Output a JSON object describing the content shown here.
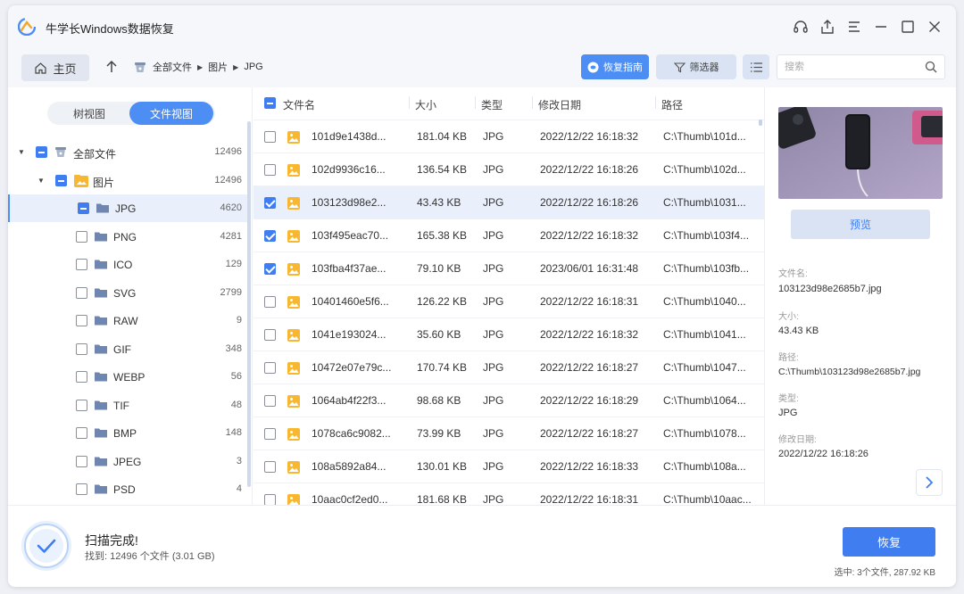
{
  "app": {
    "title": "牛学长Windows数据恢复"
  },
  "toolbar": {
    "home_label": "主页",
    "breadcrumb": [
      "全部文件",
      "图片",
      "JPG"
    ],
    "guide_label": "恢复指南",
    "filter_label": "筛选器",
    "search_placeholder": "搜索"
  },
  "sidebar": {
    "tab_tree": "树视图",
    "tab_file": "文件视图",
    "items": [
      {
        "label": "全部文件",
        "count": "12496",
        "level": 0,
        "check": "partial",
        "icon": "drive-icon"
      },
      {
        "label": "图片",
        "count": "12496",
        "level": 1,
        "check": "partial",
        "icon": "image-folder-icon"
      },
      {
        "label": "JPG",
        "count": "4620",
        "level": 2,
        "check": "partial",
        "icon": "folder-icon",
        "selected": true
      },
      {
        "label": "PNG",
        "count": "4281",
        "level": 2,
        "check": "empty",
        "icon": "folder-icon"
      },
      {
        "label": "ICO",
        "count": "129",
        "level": 2,
        "check": "empty",
        "icon": "folder-icon"
      },
      {
        "label": "SVG",
        "count": "2799",
        "level": 2,
        "check": "empty",
        "icon": "folder-icon"
      },
      {
        "label": "RAW",
        "count": "9",
        "level": 2,
        "check": "empty",
        "icon": "folder-icon"
      },
      {
        "label": "GIF",
        "count": "348",
        "level": 2,
        "check": "empty",
        "icon": "folder-icon"
      },
      {
        "label": "WEBP",
        "count": "56",
        "level": 2,
        "check": "empty",
        "icon": "folder-icon"
      },
      {
        "label": "TIF",
        "count": "48",
        "level": 2,
        "check": "empty",
        "icon": "folder-icon"
      },
      {
        "label": "BMP",
        "count": "148",
        "level": 2,
        "check": "empty",
        "icon": "folder-icon"
      },
      {
        "label": "JPEG",
        "count": "3",
        "level": 2,
        "check": "empty",
        "icon": "folder-icon"
      },
      {
        "label": "PSD",
        "count": "4",
        "level": 2,
        "check": "empty",
        "icon": "folder-icon"
      }
    ]
  },
  "table": {
    "headers": {
      "name": "文件名",
      "size": "大小",
      "type": "类型",
      "date": "修改日期",
      "path": "路径"
    },
    "rows": [
      {
        "name": "101d9e1438d...",
        "size": "181.04 KB",
        "type": "JPG",
        "date": "2022/12/22 16:18:32",
        "path": "C:\\Thumb\\101d...",
        "checked": false
      },
      {
        "name": "102d9936c16...",
        "size": "136.54 KB",
        "type": "JPG",
        "date": "2022/12/22 16:18:26",
        "path": "C:\\Thumb\\102d...",
        "checked": false
      },
      {
        "name": "103123d98e2...",
        "size": "43.43 KB",
        "type": "JPG",
        "date": "2022/12/22 16:18:26",
        "path": "C:\\Thumb\\1031...",
        "checked": true,
        "selected": true
      },
      {
        "name": "103f495eac70...",
        "size": "165.38 KB",
        "type": "JPG",
        "date": "2022/12/22 16:18:32",
        "path": "C:\\Thumb\\103f4...",
        "checked": true
      },
      {
        "name": "103fba4f37ae...",
        "size": "79.10 KB",
        "type": "JPG",
        "date": "2023/06/01 16:31:48",
        "path": "C:\\Thumb\\103fb...",
        "checked": true
      },
      {
        "name": "10401460e5f6...",
        "size": "126.22 KB",
        "type": "JPG",
        "date": "2022/12/22 16:18:31",
        "path": "C:\\Thumb\\1040...",
        "checked": false
      },
      {
        "name": "1041e193024...",
        "size": "35.60 KB",
        "type": "JPG",
        "date": "2022/12/22 16:18:32",
        "path": "C:\\Thumb\\1041...",
        "checked": false
      },
      {
        "name": "10472e07e79c...",
        "size": "170.74 KB",
        "type": "JPG",
        "date": "2022/12/22 16:18:27",
        "path": "C:\\Thumb\\1047...",
        "checked": false
      },
      {
        "name": "1064ab4f22f3...",
        "size": "98.68 KB",
        "type": "JPG",
        "date": "2022/12/22 16:18:29",
        "path": "C:\\Thumb\\1064...",
        "checked": false
      },
      {
        "name": "1078ca6c9082...",
        "size": "73.99 KB",
        "type": "JPG",
        "date": "2022/12/22 16:18:27",
        "path": "C:\\Thumb\\1078...",
        "checked": false
      },
      {
        "name": "108a5892a84...",
        "size": "130.01 KB",
        "type": "JPG",
        "date": "2022/12/22 16:18:33",
        "path": "C:\\Thumb\\108a...",
        "checked": false
      },
      {
        "name": "10aac0cf2ed0...",
        "size": "181.68 KB",
        "type": "JPG",
        "date": "2022/12/22 16:18:31",
        "path": "C:\\Thumb\\10aac...",
        "checked": false
      }
    ]
  },
  "preview": {
    "button_label": "预览",
    "filename_label": "文件名:",
    "filename": "103123d98e2685b7.jpg",
    "size_label": "大小:",
    "size": "43.43 KB",
    "path_label": "路径:",
    "path": "C:\\Thumb\\103123d98e2685b7.jpg",
    "type_label": "类型:",
    "type": "JPG",
    "date_label": "修改日期:",
    "date": "2022/12/22 16:18:26"
  },
  "footer": {
    "status_title": "扫描完成!",
    "status_detail": "找到: 12496 个文件 (3.01 GB)",
    "recover_label": "恢复",
    "selected_info": "选中: 3个文件, 287.92 KB"
  },
  "colors": {
    "accent": "#3f7df0",
    "selected_bg": "#e9effb",
    "button_light": "#d9e3f3"
  }
}
